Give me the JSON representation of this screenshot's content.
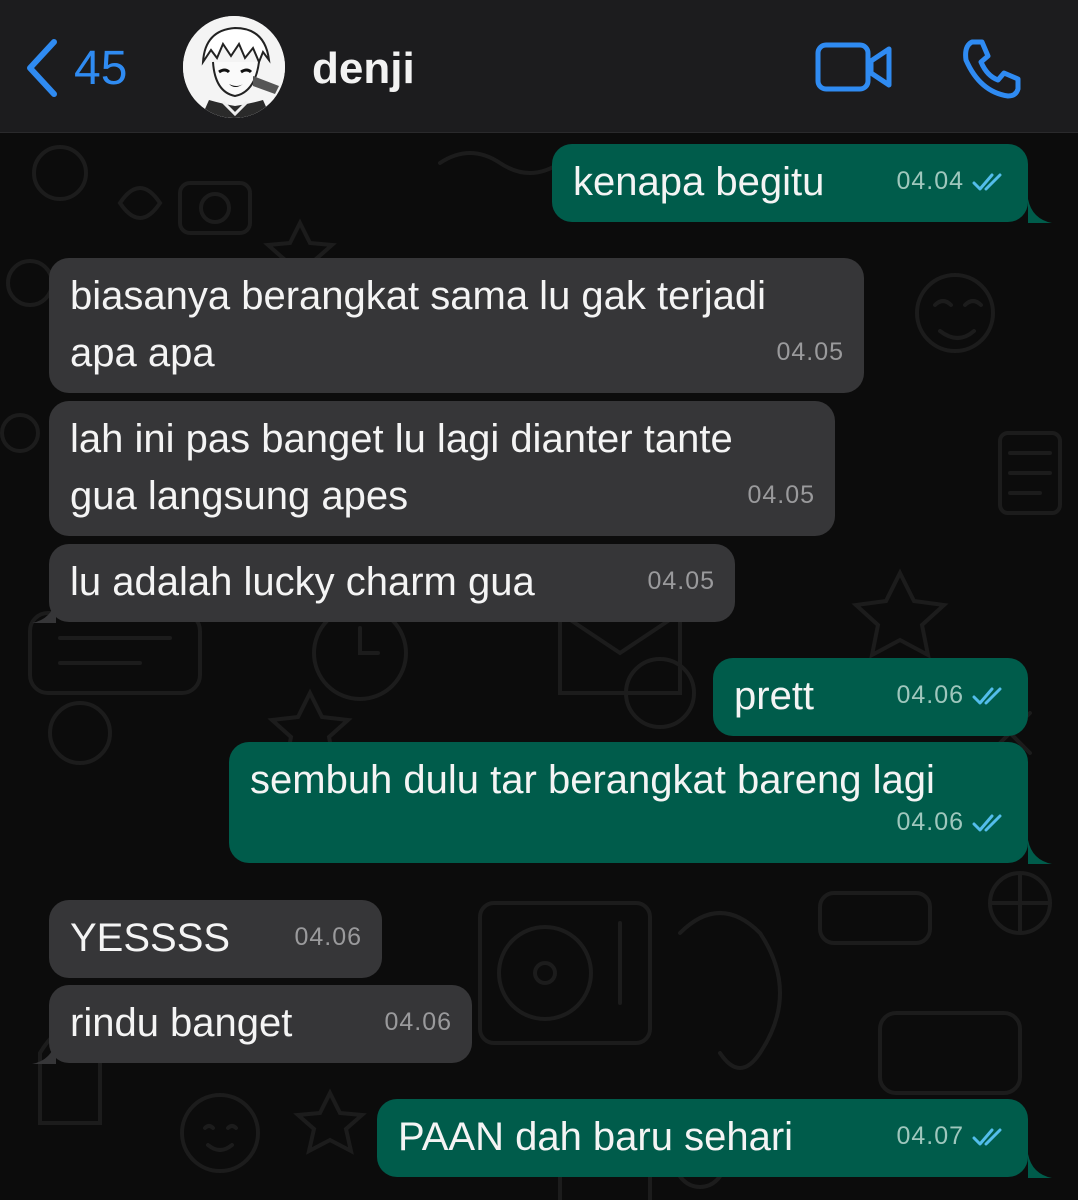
{
  "header": {
    "back_count": "45",
    "contact_name": "denji",
    "accent": "#2f8bf2"
  },
  "icons": {
    "back": "chevron-left-icon",
    "video": "video-camera-icon",
    "call": "phone-icon",
    "read": "double-check-icon"
  },
  "colors": {
    "incoming_bubble": "#363638",
    "outgoing_bubble": "#005c4b",
    "read_tick": "#53bdeb"
  },
  "messages": [
    {
      "dir": "out",
      "text": "kenapa begitu",
      "time": "04.04",
      "read": true
    },
    {
      "dir": "in",
      "text": "biasanya berangkat sama lu gak terjadi\napa apa",
      "time": "04.05"
    },
    {
      "dir": "in",
      "text": "lah ini pas banget lu lagi dianter tante\ngua langsung apes",
      "time": "04.05"
    },
    {
      "dir": "in",
      "text": "lu adalah lucky charm gua",
      "time": "04.05"
    },
    {
      "dir": "out",
      "text": "prett",
      "time": "04.06",
      "read": true
    },
    {
      "dir": "out",
      "text": "sembuh dulu tar berangkat bareng lagi",
      "time": "04.06",
      "read": true
    },
    {
      "dir": "in",
      "text": "YESSSS",
      "time": "04.06"
    },
    {
      "dir": "in",
      "text": "rindu banget",
      "time": "04.06"
    },
    {
      "dir": "out",
      "text": "PAAN dah baru sehari",
      "time": "04.07",
      "read": true
    }
  ]
}
